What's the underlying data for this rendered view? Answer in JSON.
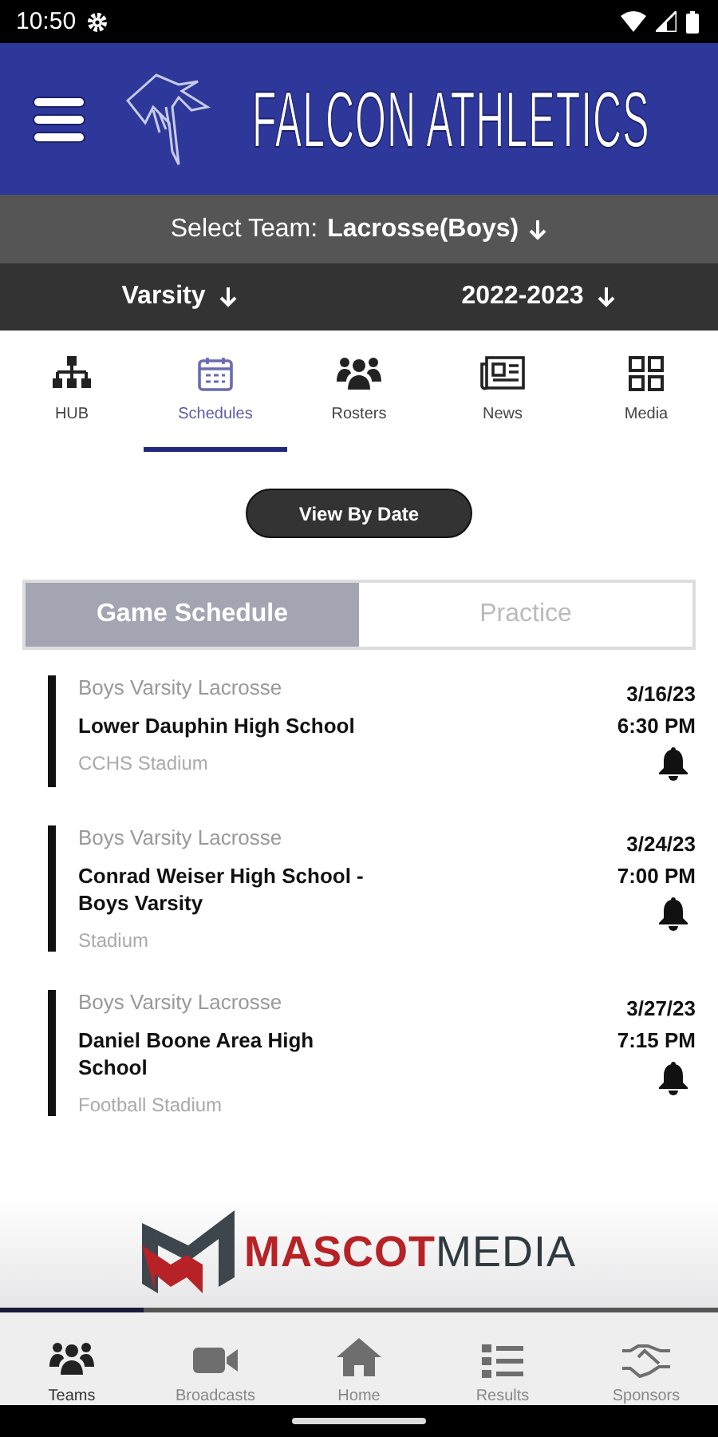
{
  "status_bar": {
    "time": "10:50"
  },
  "header": {
    "title": "FALCON ATHLETICS"
  },
  "team_selector": {
    "label": "Select Team:",
    "value": "Lacrosse(Boys)"
  },
  "filters": [
    {
      "value": "Varsity"
    },
    {
      "value": "2022-2023"
    }
  ],
  "tabs": [
    {
      "label": "HUB",
      "selected": false
    },
    {
      "label": "Schedules",
      "selected": true
    },
    {
      "label": "Rosters",
      "selected": false
    },
    {
      "label": "News",
      "selected": false
    },
    {
      "label": "Media",
      "selected": false
    }
  ],
  "view_button": "View By Date",
  "segments": [
    {
      "label": "Game Schedule",
      "selected": true
    },
    {
      "label": "Practice",
      "selected": false
    }
  ],
  "games": [
    {
      "category": "Boys Varsity Lacrosse",
      "opponent": "Lower Dauphin High School",
      "location": "CCHS Stadium",
      "date": "3/16/23",
      "time": "6:30 PM"
    },
    {
      "category": "Boys Varsity Lacrosse",
      "opponent": "Conrad Weiser High School - Boys Varsity",
      "location": "Stadium",
      "date": "3/24/23",
      "time": "7:00 PM"
    },
    {
      "category": "Boys Varsity Lacrosse",
      "opponent": "Daniel Boone Area High School",
      "location": "Football Stadium",
      "date": "3/27/23",
      "time": "7:15 PM"
    }
  ],
  "sponsor": {
    "logo_text": "**MASCOT**MEDIA"
  },
  "bottom_nav": [
    {
      "label": "Teams",
      "selected": true
    },
    {
      "label": "Broadcasts",
      "selected": false
    },
    {
      "label": "Home",
      "selected": false
    },
    {
      "label": "Results",
      "selected": false
    },
    {
      "label": "Sponsors",
      "selected": false
    }
  ]
}
